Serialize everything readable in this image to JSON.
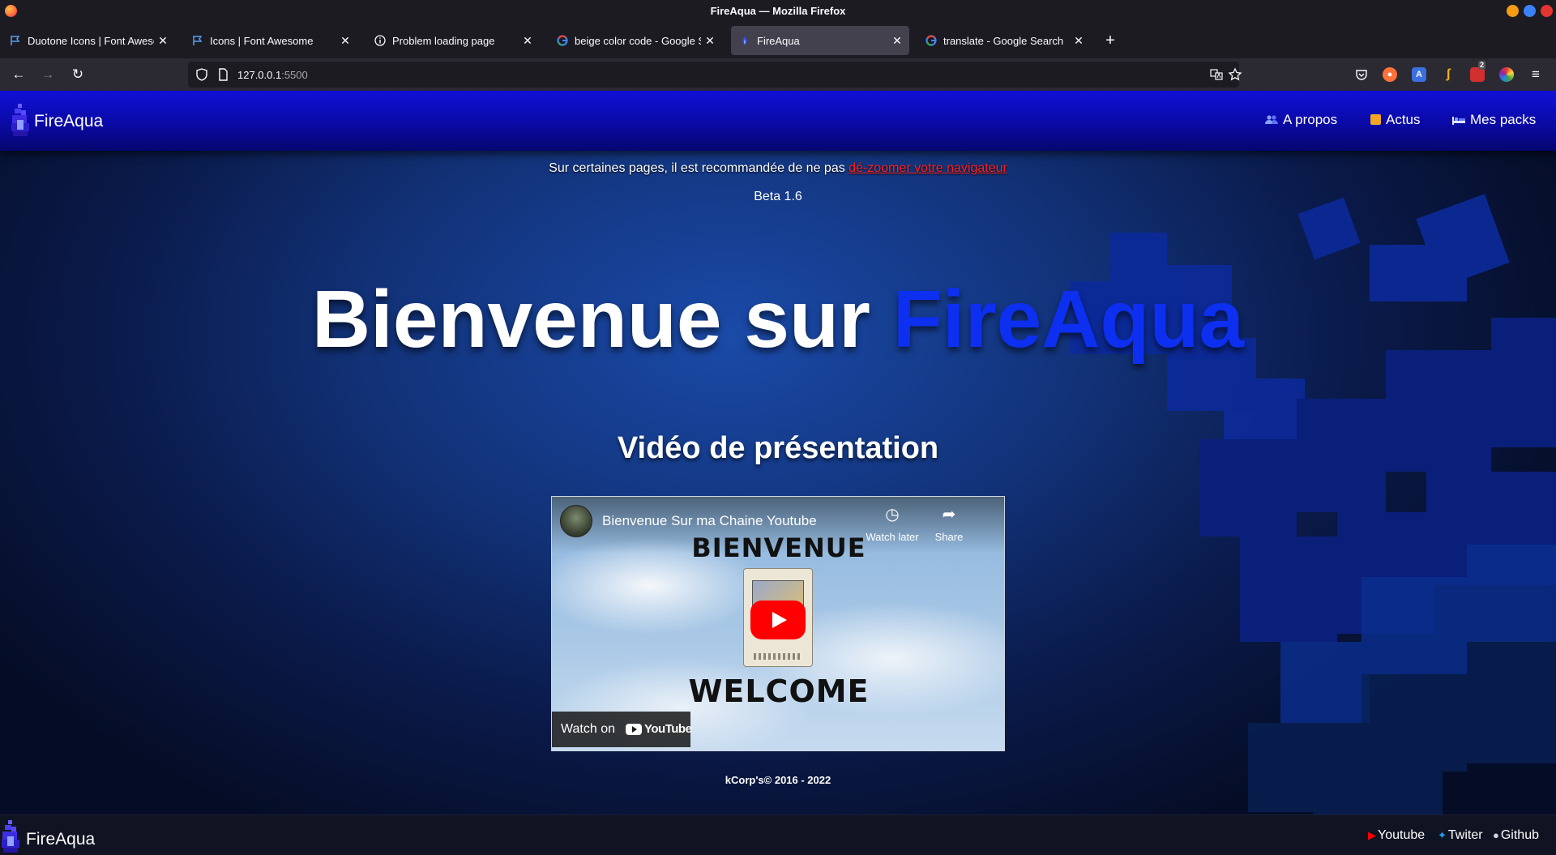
{
  "window": {
    "title": "FireAqua — Mozilla Firefox"
  },
  "tabs": [
    {
      "label": "Duotone Icons | Font Awesome",
      "favicon": "flag-icon",
      "active": false
    },
    {
      "label": "Icons | Font Awesome",
      "favicon": "flag-icon",
      "active": false
    },
    {
      "label": "Problem loading page",
      "favicon": "info-icon",
      "active": false
    },
    {
      "label": "beige color code - Google Search",
      "favicon": "google-icon",
      "active": false
    },
    {
      "label": "FireAqua",
      "favicon": "fireaqua-icon",
      "active": true
    },
    {
      "label": "translate - Google Search",
      "favicon": "google-icon",
      "active": false
    }
  ],
  "urlbar": {
    "host": "127.0.0.1",
    "port": ":5500"
  },
  "extensions": [
    {
      "name": "extension-badge",
      "count": "2"
    }
  ],
  "site": {
    "brand": "FireAqua",
    "nav": [
      {
        "label": "A propos",
        "icon": "users-icon"
      },
      {
        "label": "Actus",
        "icon": "rss-icon"
      },
      {
        "label": "Mes packs",
        "icon": "bed-icon"
      }
    ],
    "notice_text": "Sur certaines pages, il est recommandée de ne pas",
    "notice_link": "dé-zoomer votre navigateur",
    "beta": "Beta 1.6",
    "hero_prefix": "Bienvenue sur",
    "hero_highlight": "FireAqua",
    "subtitle": "Vidéo de présentation",
    "copyright": "kCorp's© 2016 - 2022"
  },
  "video": {
    "title": "Bienvenue Sur ma Chaine Youtube",
    "watch_later": "Watch later",
    "share": "Share",
    "thumb_top": "BIENVENUE",
    "thumb_bottom": "WELCOME",
    "watch_on": "Watch on",
    "youtube": "YouTube"
  },
  "footer": {
    "brand": "FireAqua",
    "links": [
      {
        "label": "Youtube",
        "icon": "youtube-icon"
      },
      {
        "label": "Twiter",
        "icon": "twitter-icon"
      },
      {
        "label": "Github",
        "icon": "github-icon"
      }
    ]
  },
  "colors": {
    "accent": "#0d2ff0",
    "navbar": "#0a0aa6",
    "link": "#ff2020"
  }
}
